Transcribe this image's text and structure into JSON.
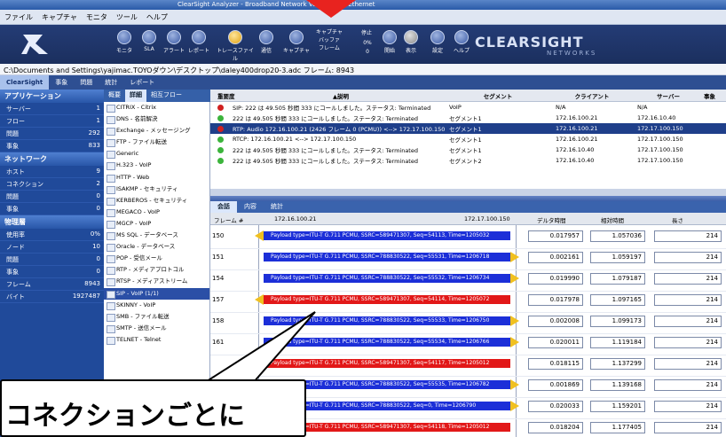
{
  "window": {
    "title": "ClearSight Analyzer - Broadband Network VoIP Gigabit Ethernet"
  },
  "menu": [
    "ファイル",
    "キャプチャ",
    "モニタ",
    "ツール",
    "ヘルプ"
  ],
  "toolbar": [
    {
      "label": "モニタ",
      "icon": "monitor-icon"
    },
    {
      "label": "SLA",
      "icon": "sla-icon"
    },
    {
      "label": "アラート",
      "icon": "alert-icon"
    },
    {
      "label": "レポート",
      "icon": "report-icon"
    },
    {
      "label": "トレースファイル",
      "icon": "trace-file-icon"
    },
    {
      "label": "通信",
      "icon": "comm-icon"
    },
    {
      "label": "キャプチャ",
      "icon": "capture-icon"
    },
    {
      "label": "キャプチャ バッファ フレーム",
      "icon": ""
    },
    {
      "label": "停止",
      "icon": ""
    },
    {
      "label": "開始",
      "icon": "play-icon"
    },
    {
      "label": "表示",
      "icon": "view-icon"
    },
    {
      "label": "設定",
      "icon": "settings-icon"
    },
    {
      "label": "ヘルプ",
      "icon": "help-icon"
    }
  ],
  "capture_counters": [
    "0%",
    "0"
  ],
  "brand": {
    "name": "CLEARSIGHT",
    "sub": "NETWORKS"
  },
  "path": "C:\\Documents and Settings\\yajimac.TOYOダウン\\デスクトップ\\daley400drop20-3.adc   フレーム: 8943",
  "view_tabs": [
    "ClearSight",
    "事象",
    "問題",
    "統計",
    "レポート"
  ],
  "left_panel": {
    "app_section": "アプリケーション",
    "app_rows": [
      {
        "label": "サーバー",
        "value": "1"
      },
      {
        "label": "フロー",
        "value": "1"
      },
      {
        "label": "問題",
        "value": "292"
      },
      {
        "label": "事象",
        "value": "833"
      }
    ],
    "net_section": "ネットワーク",
    "net_rows": [
      {
        "label": "ホスト",
        "value": "9"
      },
      {
        "label": "コネクション",
        "value": "2"
      },
      {
        "label": "問題",
        "value": "0"
      },
      {
        "label": "事象",
        "value": "0"
      }
    ],
    "phys_section": "物理層",
    "phys_rows": [
      {
        "label": "使用率",
        "value": "0%"
      },
      {
        "label": "ノード",
        "value": "10"
      },
      {
        "label": "問題",
        "value": "0"
      },
      {
        "label": "事象",
        "value": "0"
      },
      {
        "label": "フレーム",
        "value": "8943"
      },
      {
        "label": "バイト",
        "value": "1927487"
      }
    ]
  },
  "proto_tabs": [
    "概要",
    "詳細",
    "相互フロー"
  ],
  "protocols": [
    "CITRIX - Citrix",
    "DNS - 名前解決",
    "Exchange - メッセージング",
    "FTP - ファイル転送",
    "Generic",
    "H.323 - VoIP",
    "HTTP - Web",
    "ISAKMP - セキュリティ",
    "KERBEROS - セキュリティ",
    "MEGACO - VoIP",
    "MGCP - VoIP",
    "MS SQL - データベース",
    "Oracle - データベース",
    "POP - 受信メール",
    "RTP - メディアプロトコル",
    "RTSP - メディアストリーム",
    "SIP - VoIP (1/1)",
    "SKINNY - VoIP",
    "SMB - ファイル転送",
    "SMTP - 送信メール",
    "TELNET - Telnet"
  ],
  "selected_protocol_index": 16,
  "event_columns": [
    "重要度",
    "▲説明",
    "セグメント",
    "クライアント",
    "サーバー",
    "事象"
  ],
  "events": [
    {
      "sev": "red",
      "desc": "SIP: 222 は 49.505 秒間 333 にコールしました。ステータス: Terminated",
      "seg": "VoIP",
      "client": "N/A",
      "server": "N/A"
    },
    {
      "sev": "green",
      "desc": "222 は 49.505 秒間 333 にコールしました。ステータス: Terminated",
      "seg": "セグメント1",
      "client": "172.16.100.21",
      "server": "172.16.10.40"
    },
    {
      "sev": "red",
      "desc": "RTP: Audio 172.16.100.21 (2426 フレーム 0 (PCMU)) <--> 172.17.100.150",
      "seg": "セグメント1",
      "client": "172.16.100.21",
      "server": "172.17.100.150"
    },
    {
      "sev": "green",
      "desc": "RTCP: 172.16.100.21 <--> 172.17.100.150",
      "seg": "セグメント1",
      "client": "172.16.100.21",
      "server": "172.17.100.150"
    },
    {
      "sev": "green",
      "desc": "222 は 49.505 秒間 333 にコールしました。ステータス: Terminated",
      "seg": "セグメント1",
      "client": "172.16.10.40",
      "server": "172.17.100.150"
    },
    {
      "sev": "green",
      "desc": "222 は 49.505 秒間 333 にコールしました。ステータス: Terminated",
      "seg": "セグメント2",
      "client": "172.16.10.40",
      "server": "172.17.100.150"
    }
  ],
  "selected_event_index": 2,
  "bottom_tabs": [
    "会話",
    "内容",
    "統計"
  ],
  "flow_columns": {
    "frame": "フレーム #",
    "left_ip": "172.16.100.21",
    "right_ip": "172.17.100.150",
    "delta": "デルタ時間",
    "relative": "相対時間",
    "length": "長さ"
  },
  "flows": [
    {
      "frame": "150",
      "dir": "left",
      "color": "blue",
      "text": "Payload type=ITU-T G.711 PCMU, SSRC=589471307, Seq=54113, Time=1205032",
      "delta": "0.017957",
      "rel": "1.057036",
      "len": "214"
    },
    {
      "frame": "151",
      "dir": "right",
      "color": "blue",
      "text": "Payload type=ITU-T G.711 PCMU, SSRC=788830522, Seq=55531, Time=1206718",
      "delta": "0.002161",
      "rel": "1.059197",
      "len": "214"
    },
    {
      "frame": "154",
      "dir": "right",
      "color": "blue",
      "text": "Payload type=ITU-T G.711 PCMU, SSRC=788830522, Seq=55532, Time=1206734",
      "delta": "0.019990",
      "rel": "1.079187",
      "len": "214"
    },
    {
      "frame": "157",
      "dir": "left",
      "color": "red",
      "text": "Payload type=ITU-T G.711 PCMU, SSRC=589471307, Seq=54114, Time=1205072",
      "delta": "0.017978",
      "rel": "1.097165",
      "len": "214"
    },
    {
      "frame": "158",
      "dir": "right",
      "color": "blue",
      "text": "Payload type=ITU-T G.711 PCMU, SSRC=788830522, Seq=55533, Time=1206750",
      "delta": "0.002008",
      "rel": "1.099173",
      "len": "214"
    },
    {
      "frame": "161",
      "dir": "right",
      "color": "blue",
      "text": "Payload type=ITU-T G.711 PCMU, SSRC=788830522, Seq=55534, Time=1206766",
      "delta": "0.020011",
      "rel": "1.119184",
      "len": "214"
    },
    {
      "frame": "",
      "dir": "left",
      "color": "red",
      "text": "Payload type=ITU-T G.711 PCMU, SSRC=589471307, Seq=54117, Time=1205012",
      "delta": "0.018115",
      "rel": "1.137299",
      "len": "214"
    },
    {
      "frame": "",
      "dir": "right",
      "color": "blue",
      "text": "Payload type=ITU-T G.711 PCMU, SSRC=788830522, Seq=55535, Time=1206782",
      "delta": "0.001869",
      "rel": "1.139168",
      "len": "214"
    },
    {
      "frame": "",
      "dir": "right",
      "color": "blue",
      "text": "Payload type=ITU-T G.711 PCMU, SSRC=788830522, Seq=0, Time=1206790",
      "delta": "0.020033",
      "rel": "1.159201",
      "len": "214"
    },
    {
      "frame": "",
      "dir": "left",
      "color": "red",
      "text": "Payload type=ITU-T G.711 PCMU, SSRC=589471307, Seq=54118, Time=1205012",
      "delta": "0.018204",
      "rel": "1.177405",
      "len": "214"
    }
  ],
  "callout": {
    "text": "コネクションごとに"
  }
}
